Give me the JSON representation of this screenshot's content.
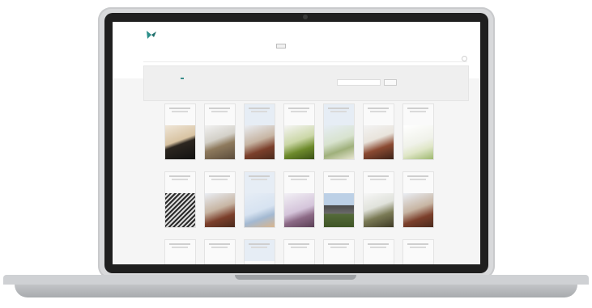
{
  "colors": {
    "accent": "#3a8e8a",
    "screen_background": "#f5f5f5",
    "laptop_body": "#d8d9db"
  },
  "logo": {
    "icon": "bird-logo-icon"
  },
  "topright": {
    "text": ""
  },
  "nav": {
    "items": [
      {
        "label": "",
        "active": false
      },
      {
        "label": "",
        "active": false
      },
      {
        "label": "",
        "active": false
      },
      {
        "label": "",
        "active": false
      },
      {
        "label": "",
        "active": true
      },
      {
        "label": "",
        "active": false
      },
      {
        "label": "",
        "active": false
      }
    ]
  },
  "breadcrumb": {
    "text": ""
  },
  "filters": {
    "left_label": "",
    "buttons": [
      {
        "label": "",
        "active": false
      },
      {
        "label": "",
        "active": false
      },
      {
        "label": "",
        "active": false
      },
      {
        "label": "",
        "active": false
      },
      {
        "label": "",
        "active": false
      },
      {
        "label": "",
        "active": true
      }
    ],
    "right_label": "",
    "search_value": "",
    "go_label": ""
  },
  "cards": [
    {
      "theme": "warm-night",
      "tint": "white"
    },
    {
      "theme": "building",
      "tint": "white"
    },
    {
      "theme": "brick",
      "tint": "blue"
    },
    {
      "theme": "grass",
      "tint": "white"
    },
    {
      "theme": "pale-green",
      "tint": "blue"
    },
    {
      "theme": "brick-dark",
      "tint": "white"
    },
    {
      "theme": "bright",
      "tint": "white"
    },
    {
      "theme": "dark-lines",
      "tint": "white"
    },
    {
      "theme": "brick",
      "tint": "white"
    },
    {
      "theme": "sky",
      "tint": "blue"
    },
    {
      "theme": "purple",
      "tint": "white"
    },
    {
      "theme": "kiosk",
      "tint": "white"
    },
    {
      "theme": "field",
      "tint": "white"
    },
    {
      "theme": "brick",
      "tint": "white"
    },
    {
      "theme": "plain",
      "tint": "white"
    },
    {
      "theme": "plain",
      "tint": "white"
    },
    {
      "theme": "plain",
      "tint": "blue"
    },
    {
      "theme": "plain",
      "tint": "white"
    },
    {
      "theme": "plain",
      "tint": "white"
    },
    {
      "theme": "plain",
      "tint": "white"
    },
    {
      "theme": "plain",
      "tint": "white"
    }
  ]
}
